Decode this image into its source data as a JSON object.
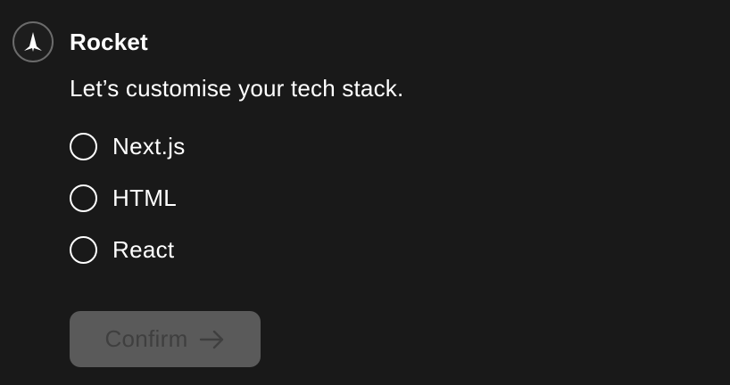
{
  "header": {
    "logo_icon": "rocket-logo-icon",
    "brand_name": "Rocket"
  },
  "prompt": {
    "question": "Let’s customise your tech stack."
  },
  "options": [
    {
      "label": "Next.js",
      "selected": false
    },
    {
      "label": "HTML",
      "selected": false
    },
    {
      "label": "React",
      "selected": false
    }
  ],
  "confirm": {
    "label": "Confirm",
    "icon": "arrow-right-icon",
    "disabled": true
  },
  "colors": {
    "background": "#191919",
    "text": "#ffffff",
    "button_bg_disabled": "#5a5a5a",
    "button_text_disabled": "#3f3f3f",
    "logo_border": "#6b6b6b"
  }
}
